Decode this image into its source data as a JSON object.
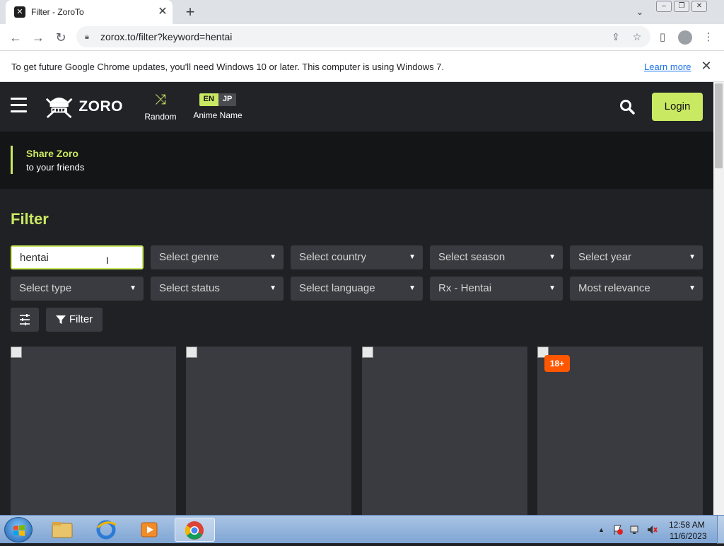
{
  "browser": {
    "tab": {
      "title": "Filter - ZoroTo",
      "favicon": "zoro-favicon-icon"
    },
    "url": "zorox.to/filter?keyword=hentai",
    "infobar": {
      "message": "To get future Google Chrome updates, you'll need Windows 10 or later. This computer is using Windows 7.",
      "link": "Learn more"
    }
  },
  "site": {
    "logo_text": "ZORO",
    "nav": {
      "random_label": "Random",
      "anime_name_label": "Anime Name",
      "lang_en": "EN",
      "lang_jp": "JP"
    },
    "login_label": "Login",
    "share": {
      "title": "Share Zoro",
      "subtitle": "to your friends"
    },
    "accent": "#cae962"
  },
  "filter": {
    "title": "Filter",
    "keyword_value": "hentai",
    "row1": [
      "Select genre",
      "Select country",
      "Select season",
      "Select year"
    ],
    "row2": [
      "Select type",
      "Select status",
      "Select language",
      "Rx - Hentai",
      "Most relevance"
    ],
    "filter_button": "Filter"
  },
  "results": {
    "badge": "18+"
  },
  "taskbar": {
    "time": "12:58 AM",
    "date": "11/6/2023"
  }
}
